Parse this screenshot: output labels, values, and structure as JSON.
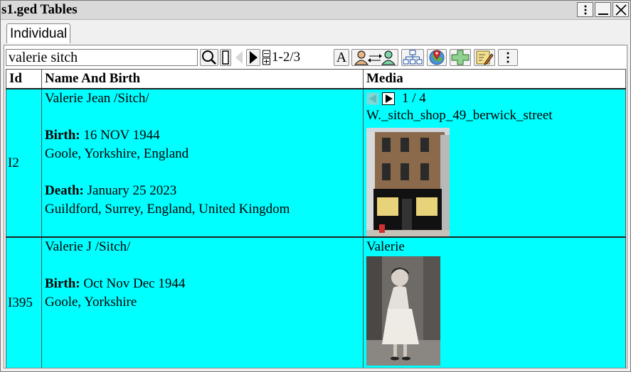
{
  "window": {
    "title": "s1.ged Tables"
  },
  "tabs": [
    {
      "label": "Individual"
    }
  ],
  "toolbar": {
    "search_value": "valerie sitch",
    "record_count": "1-2/3",
    "font_button_label": "A"
  },
  "table": {
    "headers": {
      "id": "Id",
      "name_birth": "Name And Birth",
      "media": "Media"
    },
    "rows": [
      {
        "id": "I2",
        "name": "Valerie Jean /Sitch/",
        "birth_label": "Birth:",
        "birth_date": "16 NOV 1944",
        "birth_place": "Goole, Yorkshire, England",
        "death_label": "Death:",
        "death_date": "January 25 2023",
        "death_place": "Guildford, Surrey, England, United Kingdom",
        "media_counter": "1 / 4",
        "media_title": "W._sitch_shop_49_berwick_street",
        "media_image": "photo of shop front on street"
      },
      {
        "id": "I395",
        "name": "Valerie J /Sitch/",
        "birth_label": "Birth:",
        "birth_date": "Oct Nov Dec 1944",
        "birth_place": "Goole, Yorkshire",
        "media_title": "Valerie",
        "media_image": "black and white portrait of woman in dress"
      }
    ]
  }
}
